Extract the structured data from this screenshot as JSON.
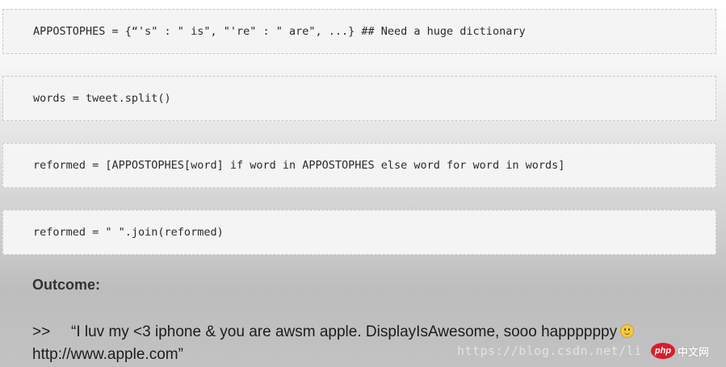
{
  "code_lines": [
    "APPOSTOPHES = {“'s\" : \" is\", \"'re\" : \" are\", ...} ## Need a huge dictionary",
    "words = tweet.split()",
    "reformed = [APPOSTOPHES[word] if word in APPOSTOPHES else word for word in words]",
    "reformed = \" \".join(reformed)"
  ],
  "outcome": {
    "title": "Outcome:",
    "prompt": ">>",
    "text_line1": "“I luv my <3 iphone & you are awsm apple. DisplayIsAwesome, sooo happppppy",
    "emoji": "smiley-face-icon",
    "text_line2": "http://www.apple.com”"
  },
  "watermark": {
    "url": "https://blog.csdn.net/li",
    "badge": "php",
    "site": "中文网"
  }
}
